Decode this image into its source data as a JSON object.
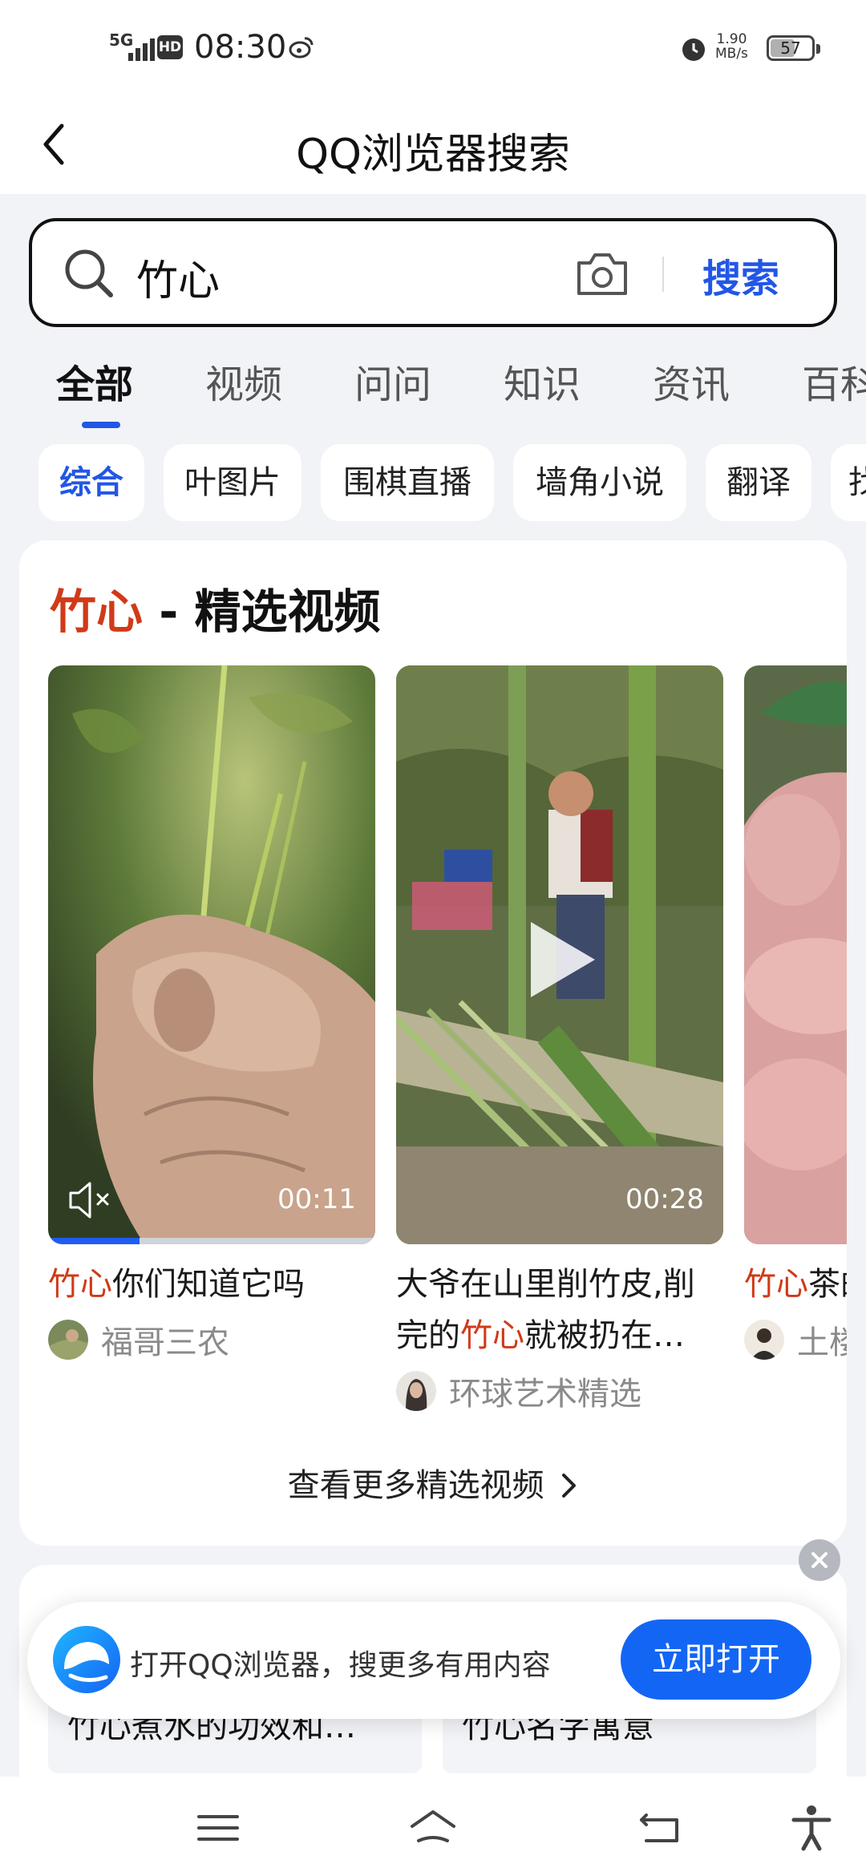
{
  "status_bar": {
    "network": "5G",
    "hd": "HD",
    "time": "08:30",
    "speed_value": "1.90",
    "speed_unit": "MB/s",
    "battery": "57"
  },
  "header": {
    "title": "QQ浏览器搜索"
  },
  "search": {
    "query": "竹心",
    "button_label": "搜索"
  },
  "tabs": [
    {
      "label": "全部",
      "active": true
    },
    {
      "label": "视频"
    },
    {
      "label": "问问"
    },
    {
      "label": "知识"
    },
    {
      "label": "资讯"
    },
    {
      "label": "百科"
    }
  ],
  "chips": [
    {
      "label": "综合",
      "active": true
    },
    {
      "label": "叶图片"
    },
    {
      "label": "围棋直播"
    },
    {
      "label": "墙角小说"
    },
    {
      "label": "翻译"
    },
    {
      "label": "找"
    }
  ],
  "video_section": {
    "title_keyword": "竹心",
    "title_rest": " - 精选视频",
    "videos": [
      {
        "title_parts": [
          {
            "text": "竹心",
            "hl": true
          },
          {
            "text": "你们知道它吗",
            "hl": false
          }
        ],
        "author": "福哥三农",
        "duration": "00:11",
        "progress": 0.28
      },
      {
        "title_parts": [
          {
            "text": "大爷在山里削竹皮,削完的",
            "hl": false
          },
          {
            "text": "竹心",
            "hl": true
          },
          {
            "text": "就被扔在…",
            "hl": false
          }
        ],
        "author": "环球艺术精选",
        "duration": "00:28"
      },
      {
        "title_parts": [
          {
            "text": "竹心",
            "hl": true
          },
          {
            "text": "茶的",
            "hl": false
          }
        ],
        "author": "土楼"
      }
    ],
    "more_label": "查看更多精选视频"
  },
  "related": [
    {
      "label": "竹心煮水的功效和…"
    },
    {
      "label": "竹心名字寓意"
    }
  ],
  "banner": {
    "text": "打开QQ浏览器，搜更多有用内容",
    "button_label": "立即打开"
  },
  "colors": {
    "accent": "#2256e6",
    "highlight": "#d03a18",
    "banner_button": "#1366f4"
  },
  "icons": [
    "back-arrow-icon",
    "search-icon",
    "camera-icon",
    "mute-icon",
    "play-icon",
    "chevron-right-icon",
    "close-icon",
    "qq-browser-logo-icon",
    "menu-icon",
    "home-icon",
    "back-nav-icon",
    "accessibility-icon"
  ]
}
